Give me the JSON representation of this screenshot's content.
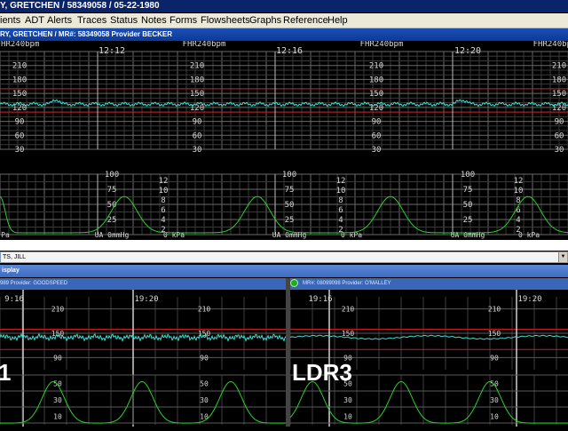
{
  "window": {
    "title": "Y, GRETCHEN / 58349058 / 05-22-1980"
  },
  "menu": [
    "ients",
    "ADT",
    "Alerts",
    "Traces",
    "Status",
    "Notes",
    "Forms",
    "Flowsheets",
    "Graphs",
    "Reference",
    "Help"
  ],
  "patient_bar": {
    "text": "RY, GRETCHEN / MR#: 58349058   Provider BECKER"
  },
  "top_strip": {
    "fhr_label": "FHR240bpm",
    "times": [
      "12:12",
      "12:16",
      "12:20"
    ],
    "fhr_ticks": [
      "210",
      "180",
      "150",
      "120",
      "90",
      "60",
      "30"
    ],
    "ua_ticks": [
      "100",
      "75",
      "50",
      "25"
    ],
    "kpa_ticks": [
      "12",
      "10",
      "8",
      "6",
      "4",
      "2"
    ],
    "ua_unit": "UA 0mmHg",
    "kpa_unit": "0 kPa",
    "left_kpa": "Pa"
  },
  "filter": {
    "value": "TS, JILL"
  },
  "display_bar": {
    "label": "isplay"
  },
  "panels": [
    {
      "header": "989 Provider: GOODSPEED",
      "bed": "1",
      "times": [
        "9:16",
        "19:20"
      ],
      "fhr_ticks": [
        "210",
        "150",
        "90"
      ],
      "ua_ticks": [
        "50",
        "30",
        "10"
      ]
    },
    {
      "header": "MR#: 08099098 Provider: O'MALLEY",
      "bed": "LDR3",
      "times": [
        "19:16",
        "19:20"
      ],
      "fhr_ticks": [
        "210",
        "150",
        "90"
      ],
      "ua_ticks": [
        "50",
        "30",
        "10"
      ]
    }
  ],
  "colors": {
    "fhr_trace": "#40e0d0",
    "ua_trace": "#2bd12b",
    "grid": "#5a5a5a",
    "baseline": "#c02020"
  }
}
